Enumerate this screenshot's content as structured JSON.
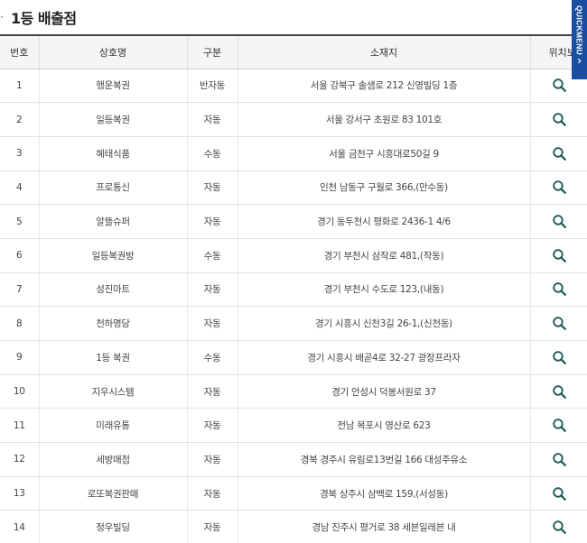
{
  "heading": {
    "bullet": "·",
    "title": "1등 배출점"
  },
  "quickmenu": {
    "label": "QUICKMENU"
  },
  "table": {
    "headers": [
      "번호",
      "상호명",
      "구분",
      "소재지",
      "위치보기"
    ],
    "rows": [
      {
        "no": "1",
        "name": "행운복권",
        "type": "반자동",
        "addr": "서울 강북구 솔샘로 212 신영빌딩 1층"
      },
      {
        "no": "2",
        "name": "일등복권",
        "type": "자동",
        "addr": "서울 강서구 초원로 83 101호"
      },
      {
        "no": "3",
        "name": "혜태식품",
        "type": "수동",
        "addr": "서울 금천구 시흥대로50길 9"
      },
      {
        "no": "4",
        "name": "프로통신",
        "type": "자동",
        "addr": "인천 남동구 구월로 366,(만수동)"
      },
      {
        "no": "5",
        "name": "알뜰슈퍼",
        "type": "자동",
        "addr": "경기 동두천시 평화로 2436-1 4/6"
      },
      {
        "no": "6",
        "name": "일등복권방",
        "type": "수동",
        "addr": "경기 부천시 삼작로 481,(작동)"
      },
      {
        "no": "7",
        "name": "성진마트",
        "type": "자동",
        "addr": "경기 부천시 수도로 123,(내동)"
      },
      {
        "no": "8",
        "name": "천하명당",
        "type": "자동",
        "addr": "경기 시흥시 신천3길 26-1,(신천동)"
      },
      {
        "no": "9",
        "name": "1등 복권",
        "type": "수동",
        "addr": "경기 시흥시 배곧4로 32-27 광장프라자"
      },
      {
        "no": "10",
        "name": "지우시스템",
        "type": "자동",
        "addr": "경기 안성시 덕봉서원로 37"
      },
      {
        "no": "11",
        "name": "미래유통",
        "type": "자동",
        "addr": "전남 목포시 영산로 623"
      },
      {
        "no": "12",
        "name": "세방매점",
        "type": "자동",
        "addr": "경북 경주시 유림로13번길 166 대성주유소"
      },
      {
        "no": "13",
        "name": "로또복권판매",
        "type": "자동",
        "addr": "경북 상주시 삼백로 159,(서성동)"
      },
      {
        "no": "14",
        "name": "정우빌딩",
        "type": "자동",
        "addr": "경남 진주시 평거로 38 세븐일레븐 내"
      }
    ]
  },
  "colors": {
    "accent": "#1a4fa0",
    "icon": "#1e5b52"
  },
  "icons": {
    "map": "search-icon",
    "quickmenu": "chevron-right-icon"
  }
}
